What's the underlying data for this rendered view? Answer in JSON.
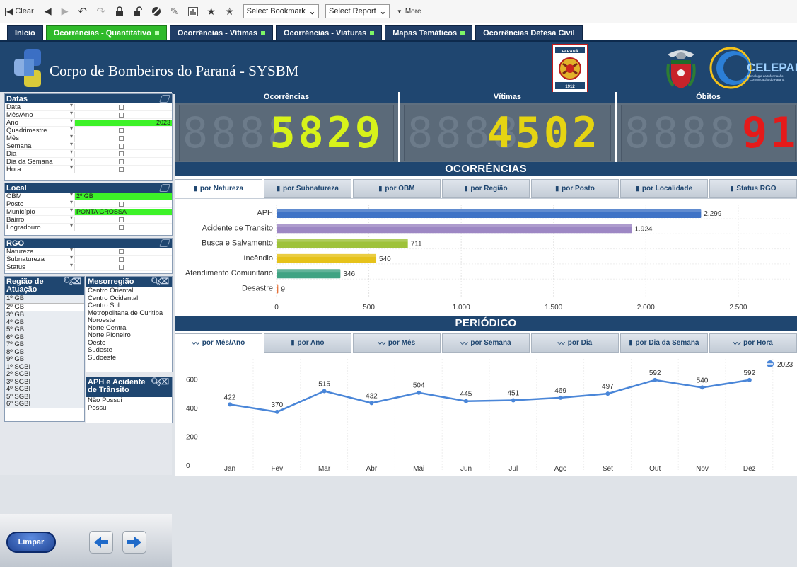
{
  "toolbar": {
    "clear_label": "Clear",
    "bookmark_select": "Select Bookmark",
    "report_select": "Select Report",
    "more_label": "More"
  },
  "tabs": [
    {
      "label": "Início",
      "indicator": false,
      "active": false
    },
    {
      "label": "Ocorrências - Quantitativo",
      "indicator": true,
      "active": true
    },
    {
      "label": "Ocorrências - Vítimas",
      "indicator": true,
      "active": false
    },
    {
      "label": "Ocorrências - Viaturas",
      "indicator": true,
      "active": false
    },
    {
      "label": "Mapas Temáticos",
      "indicator": true,
      "active": false
    },
    {
      "label": "Ocorrências Defesa Civil",
      "indicator": false,
      "active": false
    }
  ],
  "header": {
    "title": "Corpo de Bombeiros do Paraná - SYSBM",
    "emblem_top": "PARANÁ",
    "emblem_year": "1912",
    "celepar_name": "CELEPAR",
    "celepar_tagline1": "Tecnologia da Informação",
    "celepar_tagline2": "e Comunicação do Paraná"
  },
  "filters": {
    "datas": {
      "title": "Datas",
      "rows": [
        {
          "label": "Data",
          "value": "",
          "selected": false
        },
        {
          "label": "Mês/Ano",
          "value": "",
          "selected": false
        },
        {
          "label": "Ano",
          "value": "2023",
          "selected": true
        },
        {
          "label": "Quadrimestre",
          "value": "",
          "selected": false
        },
        {
          "label": "Mês",
          "value": "",
          "selected": false
        },
        {
          "label": "Semana",
          "value": "",
          "selected": false
        },
        {
          "label": "Dia",
          "value": "",
          "selected": false
        },
        {
          "label": "Dia da Semana",
          "value": "",
          "selected": false
        },
        {
          "label": "Hora",
          "value": "",
          "selected": false
        }
      ]
    },
    "local": {
      "title": "Local",
      "rows": [
        {
          "label": "OBM",
          "value": "2º GB",
          "selected": true
        },
        {
          "label": "Posto",
          "value": "",
          "selected": false
        },
        {
          "label": "Município",
          "value": "PONTA GROSSA",
          "selected": true
        },
        {
          "label": "Bairro",
          "value": "",
          "selected": false
        },
        {
          "label": "Logradouro",
          "value": "",
          "selected": false
        }
      ]
    },
    "rgo": {
      "title": "RGO",
      "rows": [
        {
          "label": "Natureza",
          "value": "",
          "selected": false
        },
        {
          "label": "Subnatureza",
          "value": "",
          "selected": false
        },
        {
          "label": "Status",
          "value": "",
          "selected": false
        }
      ]
    }
  },
  "regiao": {
    "title": "Região de Atuação",
    "items": [
      "1º GB",
      "2º GB",
      "3º GB",
      "4º GB",
      "5º GB",
      "6º GB",
      "7º GB",
      "8º GB",
      "9º GB",
      "1º SGBI",
      "2º SGBI",
      "3º SGBI",
      "4º SGBI",
      "5º SGBI",
      "6º SGBI"
    ],
    "selected_index": 1
  },
  "mesorregiao": {
    "title": "Mesorregião",
    "items": [
      "Centro Oriental",
      "Centro Ocidental",
      "Centro Sul",
      "Metropolitana de Curitiba",
      "Noroeste",
      "Norte Central",
      "Norte Pioneiro",
      "Oeste",
      "Sudeste",
      "Sudoeste"
    ]
  },
  "aph": {
    "title": "APH e Acidente de Trânsito",
    "items": [
      "Não Possui",
      "Possui"
    ]
  },
  "actions": {
    "limpar_label": "Limpar"
  },
  "kpis": [
    {
      "title": "Ocorrências",
      "value": "5829",
      "ghost": "8888",
      "color": "#d7f21a"
    },
    {
      "title": "Vítimas",
      "value": "4502",
      "ghost": "8888",
      "color": "#e5d412"
    },
    {
      "title": "Óbitos",
      "value": "91",
      "ghost": "8888",
      "color": "#e51a1a"
    }
  ],
  "ocorrencias": {
    "title": "OCORRÊNCIAS",
    "buttons": [
      "por Natureza",
      "por Subnatureza",
      "por OBM",
      "por Região",
      "por Posto",
      "por Localidade",
      "Status RGO"
    ],
    "selected_index": 0
  },
  "periodico": {
    "title": "PERIÓDICO",
    "buttons": [
      "por Mês/Ano",
      "por Ano",
      "por Mês",
      "por Semana",
      "por Dia",
      "por Dia da Semana",
      "por Hora"
    ],
    "button_icons": [
      "line",
      "bar",
      "line",
      "line",
      "line",
      "bar",
      "line"
    ],
    "selected_index": 0
  },
  "chart_data": [
    {
      "type": "bar",
      "orientation": "horizontal",
      "categories": [
        "APH",
        "Acidente de Transito",
        "Busca e Salvamento",
        "Incêndio",
        "Atendimento Comunitario",
        "Desastre"
      ],
      "values": [
        2299,
        1924,
        711,
        540,
        346,
        9
      ],
      "value_labels": [
        "2.299",
        "1.924",
        "711",
        "540",
        "346",
        "9"
      ],
      "colors": [
        "#3f73c6",
        "#9d87c4",
        "#9ec23a",
        "#e6c21a",
        "#3fa383",
        "#e8743b"
      ],
      "xticks": [
        0,
        500,
        1000,
        1500,
        2000,
        2500
      ],
      "xtick_labels": [
        "0",
        "500",
        "1.000",
        "1.500",
        "2.000",
        "2.500"
      ],
      "xlim": [
        0,
        2780
      ],
      "grid": true
    },
    {
      "type": "line",
      "categories": [
        "Jan",
        "Fev",
        "Mar",
        "Abr",
        "Mai",
        "Jun",
        "Jul",
        "Ago",
        "Set",
        "Out",
        "Nov",
        "Dez"
      ],
      "series": [
        {
          "name": "2023",
          "values": [
            422,
            370,
            515,
            432,
            504,
            445,
            451,
            469,
            497,
            592,
            540,
            592
          ],
          "color": "#4a86d8"
        }
      ],
      "yticks": [
        0,
        200,
        400,
        600
      ],
      "ylim": [
        0,
        690
      ],
      "legend": "top-right",
      "grid": true
    }
  ]
}
